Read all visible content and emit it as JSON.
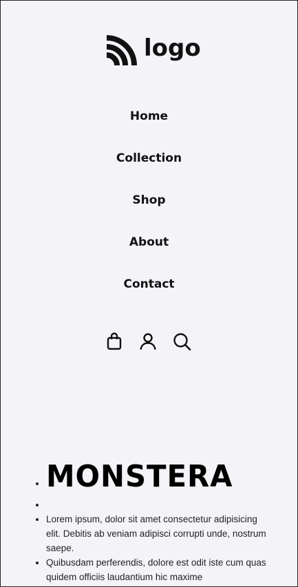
{
  "brand": {
    "logo_text": "logo"
  },
  "nav": {
    "items": [
      {
        "label": "Home"
      },
      {
        "label": "Collection"
      },
      {
        "label": "Shop"
      },
      {
        "label": "About"
      },
      {
        "label": "Contact"
      }
    ]
  },
  "actions": {
    "icons": [
      "shopping-bag-icon",
      "user-icon",
      "search-icon"
    ]
  },
  "content": {
    "title": "MONSTERA",
    "second_item": "",
    "paragraph_1": "Lorem ipsum, dolor sit amet consectetur adipisicing elit. Debitis ab veniam adipisci corrupti unde, nostrum saepe.",
    "paragraph_2": "Quibusdam perferendis, dolore est odit iste cum quas quidem officiis laudantium hic maxime"
  }
}
